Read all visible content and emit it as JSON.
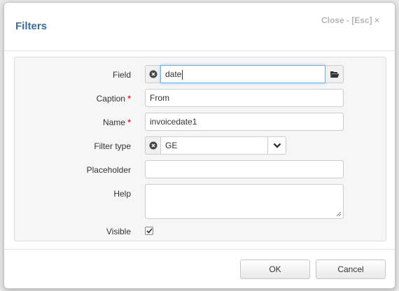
{
  "dialog": {
    "title": "Filters",
    "close_label": "Close - [Esc] ×"
  },
  "form": {
    "field": {
      "label": "Field",
      "value": "date"
    },
    "caption": {
      "label": "Caption",
      "required_mark": "*",
      "value": "From"
    },
    "name": {
      "label": "Name",
      "required_mark": "*",
      "value": "invoicedate1"
    },
    "filter_type": {
      "label": "Filter type",
      "value": "GE"
    },
    "placeholder": {
      "label": "Placeholder",
      "value": ""
    },
    "help": {
      "label": "Help",
      "value": ""
    },
    "visible": {
      "label": "Visible",
      "checked": true
    }
  },
  "footer": {
    "ok_label": "OK",
    "cancel_label": "Cancel"
  },
  "colors": {
    "title": "#3a6e99",
    "required": "#cc3333",
    "focus_border": "#66afe9"
  },
  "icons": {
    "clear": "circle-x-icon",
    "browse": "folder-open-icon",
    "dropdown": "chevron-down-icon",
    "check": "checkmark-icon"
  }
}
